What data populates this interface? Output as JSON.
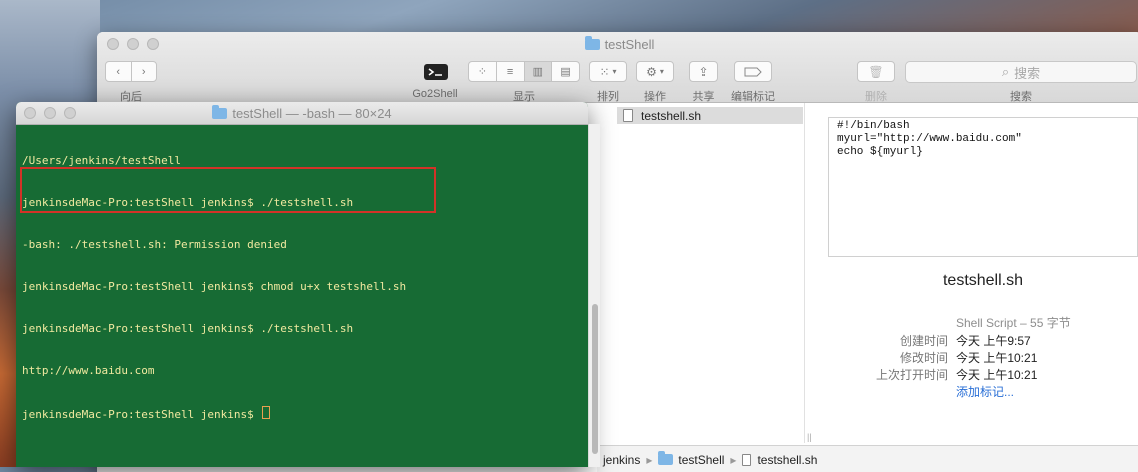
{
  "finder": {
    "title": "testShell",
    "toolbar": {
      "back_label": "向后",
      "go2shell_label": "Go2Shell",
      "view_label": "显示",
      "arrange_label": "排列",
      "action_label": "操作",
      "share_label": "共享",
      "tags_label": "编辑标记",
      "delete_label": "删除",
      "search_label": "搜索",
      "search_placeholder": "搜索"
    },
    "file": "testshell.sh",
    "preview": {
      "lines": [
        "#!/bin/bash",
        "myurl=\"http://www.baidu.com\"",
        "echo ${myurl}"
      ],
      "name": "testshell.sh",
      "kind": "Shell Script – 55 字节",
      "created_label": "创建时间",
      "created_value": "今天 上午9:57",
      "modified_label": "修改时间",
      "modified_value": "今天 上午10:21",
      "opened_label": "上次打开时间",
      "opened_value": "今天 上午10:21",
      "add_tags": "添加标记..."
    },
    "path": [
      "jenkins",
      "testShell",
      "testshell.sh"
    ]
  },
  "terminal": {
    "title": "testShell — -bash — 80×24",
    "lines": [
      "/Users/jenkins/testShell",
      "jenkinsdeMac-Pro:testShell jenkins$ ./testshell.sh",
      "-bash: ./testshell.sh: Permission denied",
      "jenkinsdeMac-Pro:testShell jenkins$ chmod u+x testshell.sh",
      "jenkinsdeMac-Pro:testShell jenkins$ ./testshell.sh",
      "http://www.baidu.com",
      "jenkinsdeMac-Pro:testShell jenkins$ "
    ]
  },
  "colors": {
    "terminal_bg": "#176b34",
    "terminal_text": "#f1e9a0",
    "highlight_box": "#d33227",
    "link": "#2a6fd6"
  }
}
